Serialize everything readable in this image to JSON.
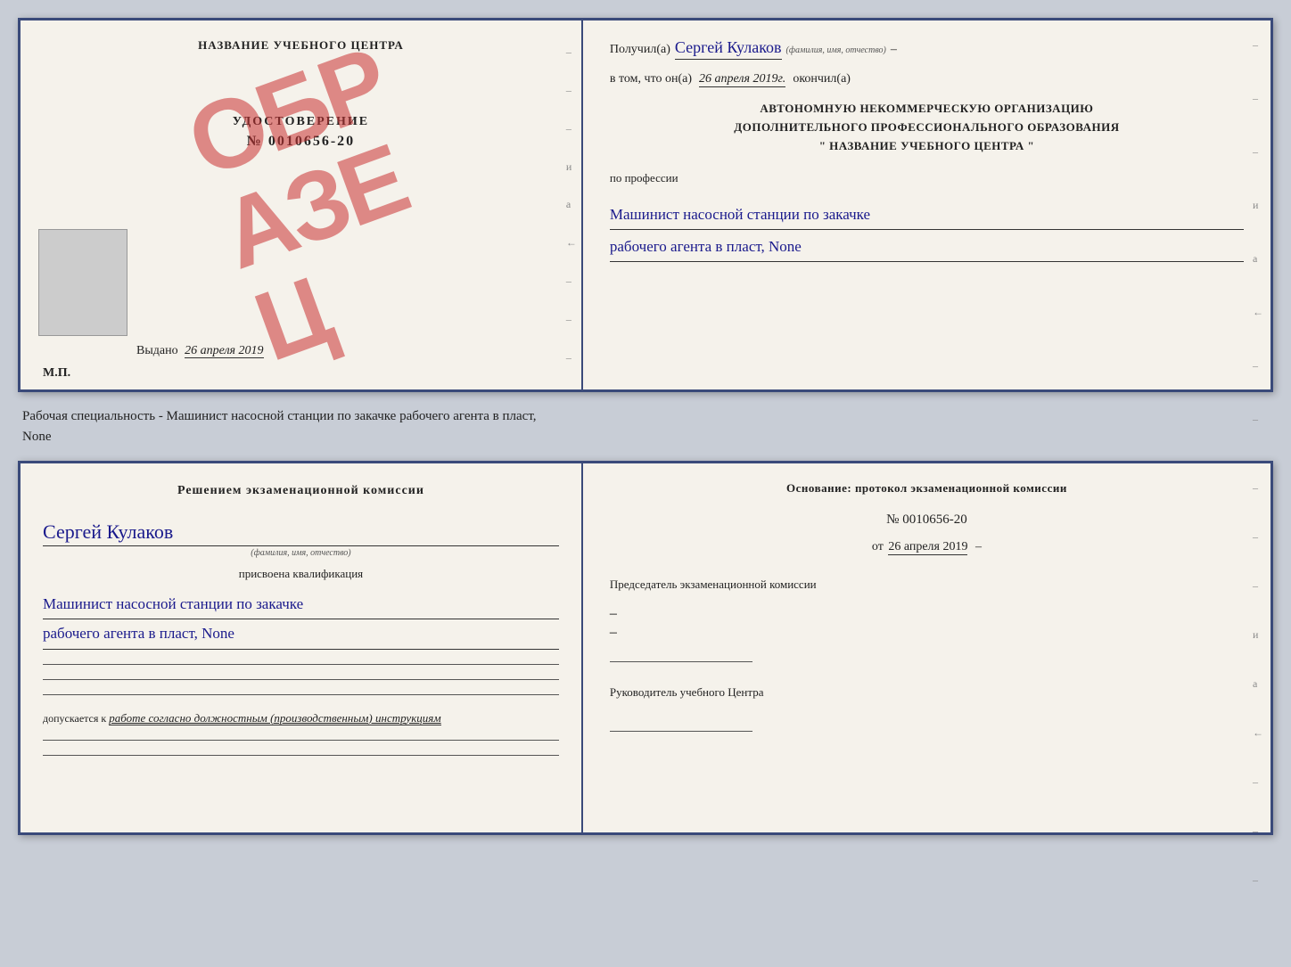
{
  "page": {
    "background_color": "#c8cdd6"
  },
  "top_doc": {
    "left": {
      "center_title": "НАЗВАНИЕ УЧЕБНОГО ЦЕНТРА",
      "stamp_text": "ОБРАЗЕЦ",
      "udostoverenie": "УДОСТОВЕРЕНИЕ",
      "number": "№ 0010656-20",
      "vydano_label": "Выдано",
      "vydano_date": "26 апреля 2019",
      "mp": "М.П."
    },
    "right": {
      "poluchil_label": "Получил(а)",
      "poluchil_name": "Сергей Кулаков",
      "familiya_hint": "(фамилия, имя, отчество)",
      "vtom_label": "в том, что он(а)",
      "vtom_date": "26 апреля 2019г.",
      "okonchil_label": "окончил(а)",
      "org_line1": "АВТОНОМНУЮ НЕКОММЕРЧЕСКУЮ ОРГАНИЗАЦИЮ",
      "org_line2": "ДОПОЛНИТЕЛЬНОГО ПРОФЕССИОНАЛЬНОГО ОБРАЗОВАНИЯ",
      "org_line3": "\"  НАЗВАНИЕ УЧЕБНОГО ЦЕНТРА  \"",
      "po_professii": "по профессии",
      "profession_line1": "Машинист насосной станции по закачке",
      "profession_line2": "рабочего агента в пласт, None"
    }
  },
  "middle": {
    "text": "Рабочая специальность - Машинист насосной станции по закачке рабочего агента в пласт,",
    "text2": "None"
  },
  "bottom_doc": {
    "left": {
      "commission_title": "Решением экзаменационной комиссии",
      "person_name": "Сергей Кулаков",
      "familiya_hint": "(фамилия, имя, отчество)",
      "prisvoena": "присвоена квалификация",
      "qual_line1": "Машинист насосной станции по закачке",
      "qual_line2": "рабочего агента в пласт, None",
      "dopuskaetsya_label": "допускается к",
      "dopuskaetsya_text": "работе согласно должностным (производственным) инструкциям"
    },
    "right": {
      "osnovanie_title": "Основание: протокол экзаменационной комиссии",
      "protocol_num": "№ 0010656-20",
      "ot_label": "от",
      "ot_date": "26 апреля 2019",
      "predsedatel_label": "Председатель экзаменационной комиссии",
      "rukovoditel_label": "Руководитель учебного Центра"
    }
  }
}
